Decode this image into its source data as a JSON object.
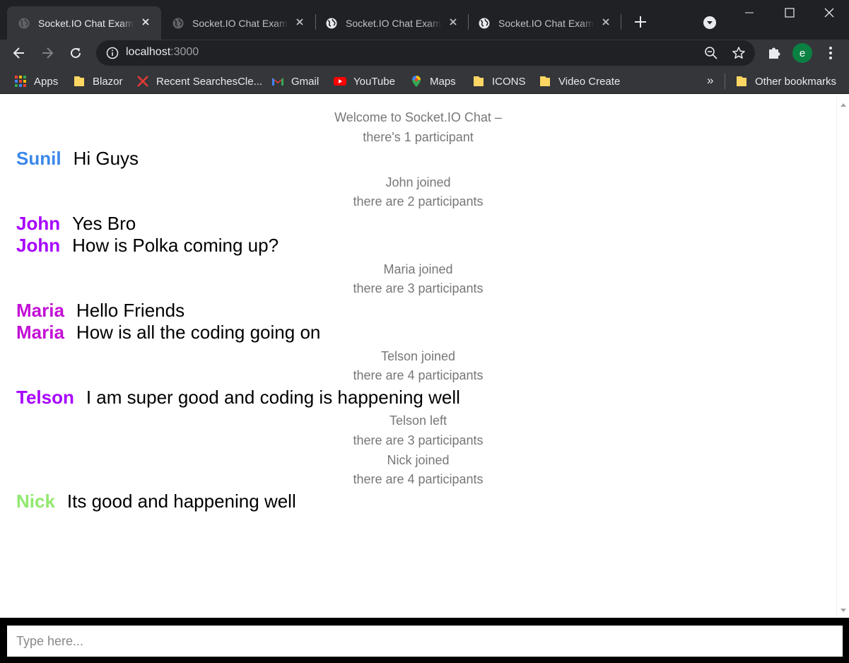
{
  "browser": {
    "tabs": [
      {
        "title": "Socket.IO Chat Example"
      },
      {
        "title": "Socket.IO Chat Example"
      },
      {
        "title": "Socket.IO Chat Example"
      },
      {
        "title": "Socket.IO Chat Example"
      }
    ],
    "url_host": "localhost",
    "url_port": ":3000",
    "profile_initial": "e",
    "bookmarks": [
      "Apps",
      "Blazor",
      "Recent SearchesCle...",
      "Gmail",
      "YouTube",
      "Maps",
      "ICONS",
      "Video Create"
    ],
    "more_bookmarks_glyph": "»",
    "other_bookmarks": "Other bookmarks"
  },
  "chat": {
    "welcome": "Welcome to Socket.IO Chat –",
    "log_lines": [
      "there's 1 participant",
      "John joined",
      "there are 2 participants",
      "Maria joined",
      "there are 3 participants",
      "Telson joined",
      "there are 4 participants",
      "Telson left",
      "there are 3 participants",
      "Nick joined",
      "there are 4 participants"
    ],
    "messages": [
      {
        "user": "Sunil",
        "color": "#3b88eb",
        "text": "Hi Guys"
      },
      {
        "user": "John",
        "color": "#a700ff",
        "text": "Yes Bro"
      },
      {
        "user": "John",
        "color": "#a700ff",
        "text": "How is Polka coming up?"
      },
      {
        "user": "Maria",
        "color": "#c20fd5",
        "text": "Hello Friends"
      },
      {
        "user": "Maria",
        "color": "#c20fd5",
        "text": "How is all the coding going on"
      },
      {
        "user": "Telson",
        "color": "#a700ff",
        "text": "I am super good and coding is happening well"
      },
      {
        "user": "Nick",
        "color": "#91e870",
        "text": "Its good and happening well"
      }
    ],
    "input_placeholder": "Type here..."
  }
}
